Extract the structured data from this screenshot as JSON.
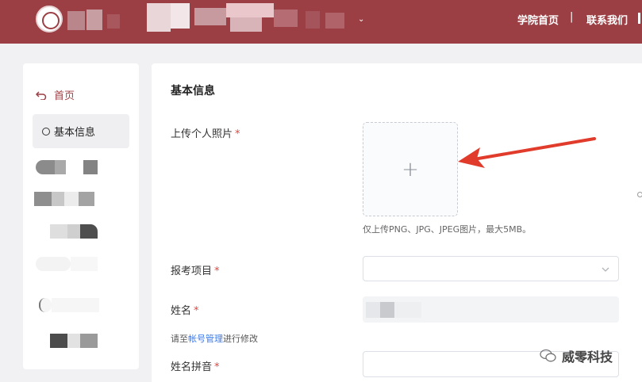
{
  "header": {
    "nav_links": [
      "学院首页",
      "|",
      "联系我们"
    ],
    "caret": "⌄"
  },
  "sidebar": {
    "home_label": "首页",
    "active_label": "基本信息"
  },
  "main": {
    "section_title": "基本信息",
    "fields": [
      {
        "label": "上传个人照片",
        "required_mark": "*"
      },
      {
        "label": "报考项目",
        "required_mark": "*"
      },
      {
        "label": "姓名",
        "required_mark": "*"
      },
      {
        "label": "姓名拼音",
        "required_mark": "*"
      }
    ],
    "upload_plus": "+",
    "upload_hint": "仅上传PNG、JPG、JPEG图片，最大5MB。",
    "edit_note_prefix": "请至",
    "edit_note_link": "帐号管理",
    "edit_note_suffix": "进行修改"
  },
  "watermark": {
    "text": "威零科技"
  },
  "colors": {
    "brand": "#9c3f44",
    "required": "#e2453f",
    "link": "#3b78e7",
    "arrow": "#e13b2b"
  }
}
